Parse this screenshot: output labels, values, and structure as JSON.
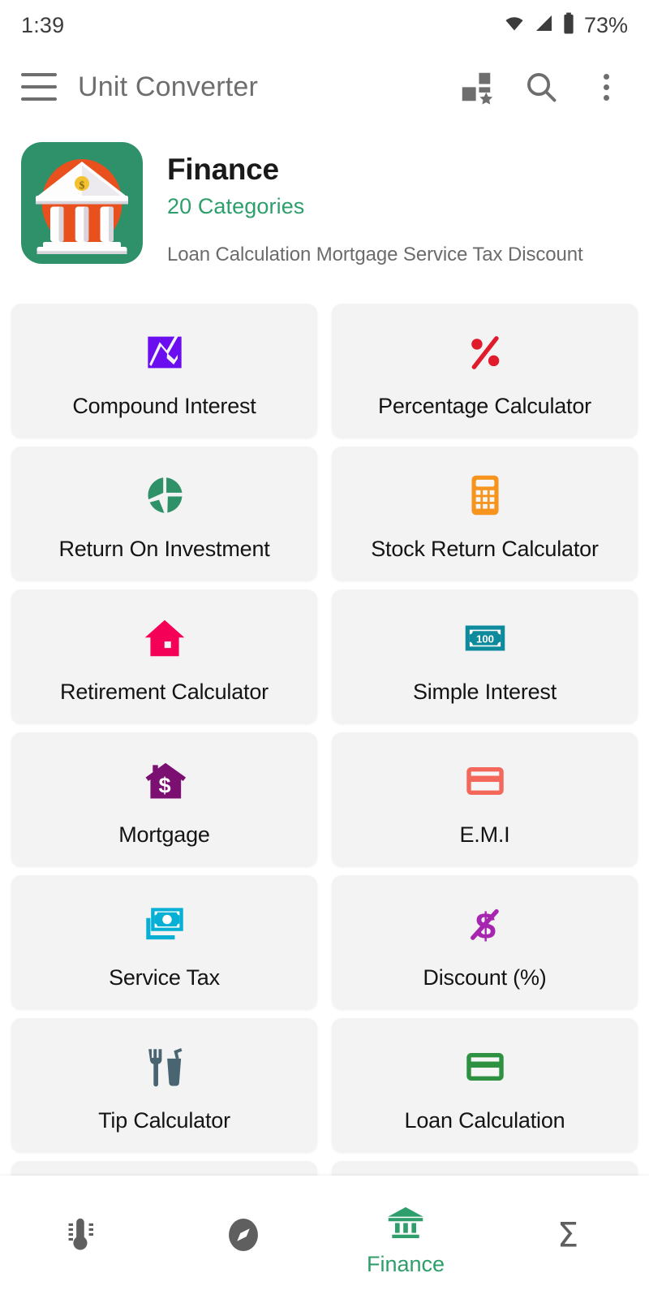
{
  "status_bar": {
    "time": "1:39",
    "battery_percent": "73%",
    "icons": [
      "wifi-icon",
      "cellular-signal-icon",
      "battery-icon"
    ]
  },
  "app_bar": {
    "title": "Unit Converter",
    "menu_icon": "hamburger-menu-icon",
    "actions": [
      {
        "icon": "grid-favorite-icon"
      },
      {
        "icon": "search-icon"
      },
      {
        "icon": "overflow-menu-icon"
      }
    ]
  },
  "category_header": {
    "icon": "bank-building-icon",
    "title": "Finance",
    "subtitle": "20 Categories",
    "description": "Loan Calculation Mortgage Service Tax Discount",
    "icon_bg_color": "#2F9169",
    "icon_circle_color": "#E8501E",
    "subtitle_color": "#2E9E6B"
  },
  "tiles": [
    {
      "label": "Compound Interest",
      "icon": "line-chart-icon",
      "color": "#6A0DEF"
    },
    {
      "label": "Percentage Calculator",
      "icon": "percent-icon",
      "color": "#E01B2B"
    },
    {
      "label": "Return On Investment",
      "icon": "pie-chart-icon",
      "color": "#2E9168"
    },
    {
      "label": "Stock Return Calculator",
      "icon": "calculator-icon",
      "color": "#F7941E"
    },
    {
      "label": "Retirement Calculator",
      "icon": "house-icon",
      "color": "#F50057"
    },
    {
      "label": "Simple Interest",
      "icon": "banknote-100-icon",
      "color": "#0D8B9C"
    },
    {
      "label": "Mortgage",
      "icon": "house-dollar-icon",
      "color": "#7B1072"
    },
    {
      "label": "E.M.I",
      "icon": "credit-card-icon",
      "color": "#F4685C"
    },
    {
      "label": "Service Tax",
      "icon": "money-stack-icon",
      "color": "#06AFD4"
    },
    {
      "label": "Discount (%)",
      "icon": "dollar-slash-icon",
      "color": "#A626B0"
    },
    {
      "label": "Tip Calculator",
      "icon": "fork-drink-icon",
      "color": "#4A6572"
    },
    {
      "label": "Loan Calculation",
      "icon": "credit-card-icon",
      "color": "#2E9142"
    }
  ],
  "banknote_value": "100",
  "bottom_nav": {
    "active_color": "#2E9E6B",
    "inactive_color": "#5F5F5F",
    "items": [
      {
        "icon": "thermometer-icon",
        "label": "",
        "active": false
      },
      {
        "icon": "compass-icon",
        "label": "",
        "active": false
      },
      {
        "icon": "bank-icon",
        "label": "Finance",
        "active": true
      },
      {
        "icon": "sigma-icon",
        "label": "",
        "active": false
      }
    ]
  }
}
